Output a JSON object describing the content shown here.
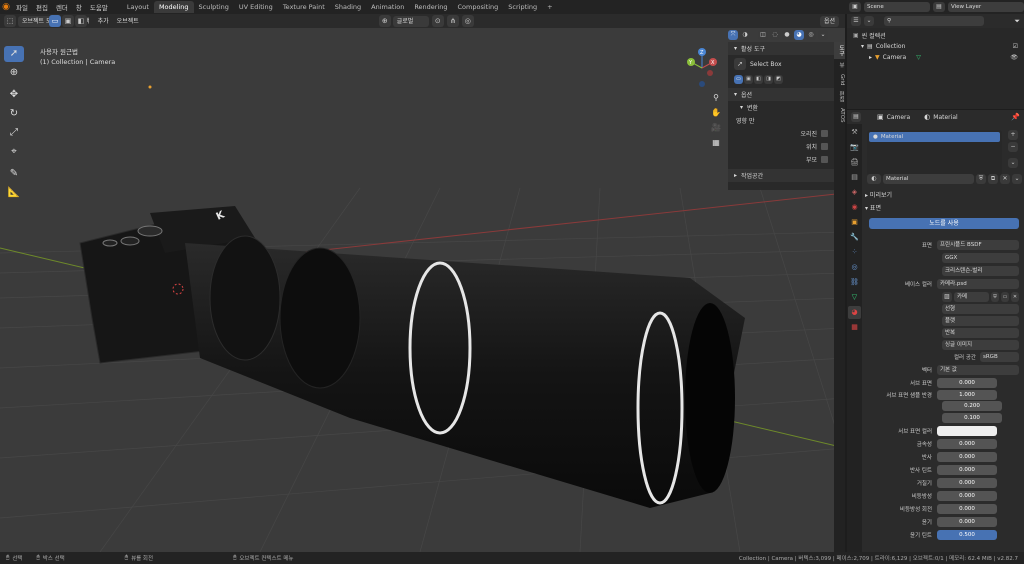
{
  "menubar": {
    "items": [
      "파일",
      "편집",
      "렌더",
      "창",
      "도움말"
    ],
    "workspaces": [
      "Layout",
      "Modeling",
      "Sculpting",
      "UV Editing",
      "Texture Paint",
      "Shading",
      "Animation",
      "Rendering",
      "Compositing",
      "Scripting"
    ],
    "active_workspace": "Modeling",
    "add_tab": "+",
    "scene_label": "Scene",
    "view_layer_label": "View Layer"
  },
  "viewport_header": {
    "mode": "오브젝트 모드",
    "menus": [
      "뷰",
      "선택",
      "추가",
      "오브젝트"
    ],
    "transform_orientation": "글로벌",
    "options": "옵션"
  },
  "viewport": {
    "view_name": "사용자 원근법",
    "collection_info": "(1) Collection | Camera",
    "axes": {
      "x": "X",
      "y": "Y",
      "z": "Z"
    }
  },
  "npanel": {
    "active_tool_header": "활성 도구",
    "tool_name": "Select Box",
    "options_header": "옵션",
    "transform_header": "변환",
    "affect_only": "영향 만",
    "origins": "오리진",
    "locations": "위치",
    "parents": "부모",
    "workspace_header": "작업공간",
    "tabs": [
      "도구",
      "뷰",
      "Grid",
      "편집",
      "ATOS"
    ]
  },
  "outliner": {
    "scene_collection": "씬 컬렉션",
    "collection": "Collection",
    "camera": "Camera"
  },
  "properties": {
    "breadcrumb_object": "Camera",
    "breadcrumb_material": "Material",
    "slot_name": "Material",
    "material_name": "Material",
    "preview_header": "미리보기",
    "surface_header": "표면",
    "use_nodes": "노드를 사용",
    "rows": [
      {
        "label": "표면",
        "value": "프린시플드 BSDF"
      },
      {
        "label": "",
        "value": "GGX"
      },
      {
        "label": "",
        "value": "크리스텐슨-벌리"
      },
      {
        "label": "베이스 컬러",
        "value": "카메라.psd"
      }
    ],
    "image_name": "카메",
    "image_settings": [
      {
        "label": "",
        "value": "선형"
      },
      {
        "label": "",
        "value": "플랫"
      },
      {
        "label": "",
        "value": "반복"
      },
      {
        "label": "",
        "value": "싱글 이미지"
      },
      {
        "label": "컬러 공간",
        "value": "sRGB"
      }
    ],
    "vector_label": "벡터",
    "vector_value": "기본 값",
    "numeric": [
      {
        "label": "서브 표면",
        "value": "0.000"
      },
      {
        "label": "서브 표면 샘플 반경",
        "value": "1.000"
      },
      {
        "label": "",
        "value": "0.200"
      },
      {
        "label": "",
        "value": "0.100"
      },
      {
        "label": "서브 표면 컬러",
        "value": ""
      },
      {
        "label": "금속성",
        "value": "0.000"
      },
      {
        "label": "반사",
        "value": "0.000"
      },
      {
        "label": "반사 틴트",
        "value": "0.000"
      },
      {
        "label": "거칠기",
        "value": "0.000"
      },
      {
        "label": "비등방성",
        "value": "0.000"
      },
      {
        "label": "비등방성 회전",
        "value": "0.000"
      },
      {
        "label": "윤기",
        "value": "0.000"
      },
      {
        "label": "윤기 틴트",
        "value": "0.500"
      }
    ]
  },
  "statusbar": {
    "select": "선택",
    "box_select": "박스 선택",
    "rotate_view": "뷰를 회전",
    "context_menu": "오브젝트 컨텍스트 메뉴",
    "stats": "Collection | Camera | 버텍스:3,099 | 페이스:2,709 | 트라이:6,129 | 오브젝트:0/1 | 메모리: 62.4 MiB | v2.82.7"
  },
  "colors": {
    "accent": "#4772b3",
    "viewport_bg": "#3b3b3b",
    "x_axis": "#c44d4d",
    "y_axis": "#8bbf3a",
    "z_axis": "#4a86d4"
  }
}
